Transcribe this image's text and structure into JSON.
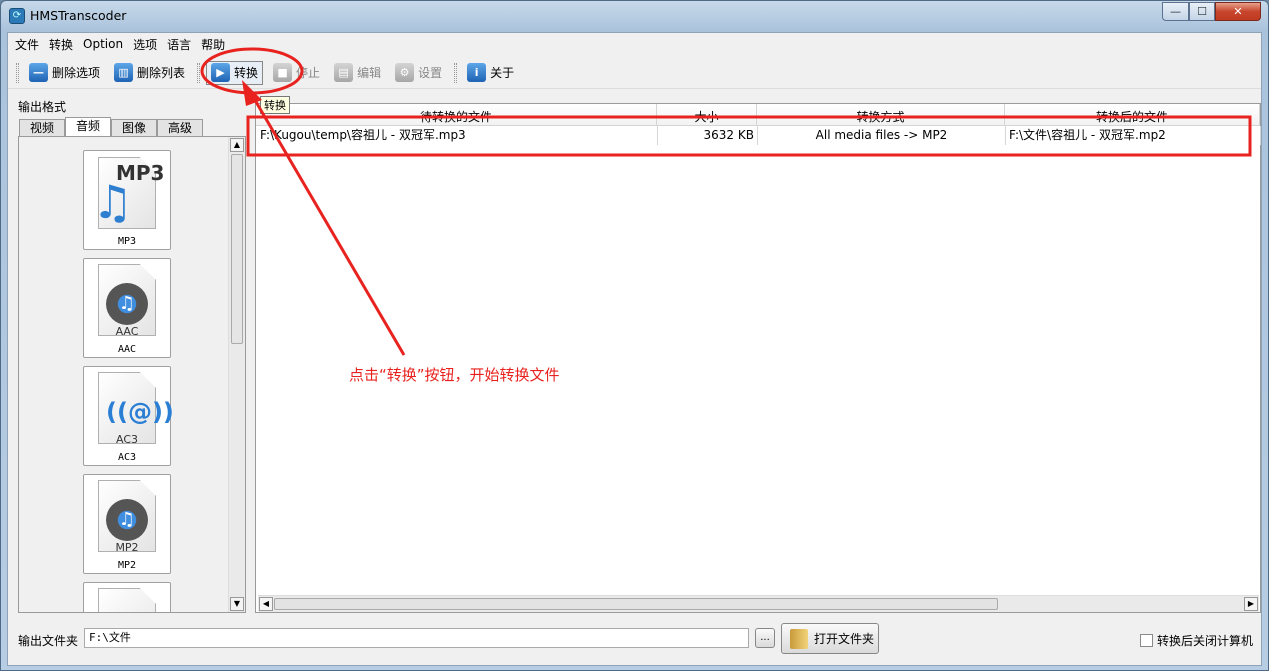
{
  "window": {
    "title": "HMSTranscoder",
    "min": "—",
    "max": "☐",
    "close": "✕"
  },
  "menu": [
    "文件",
    "转换",
    "Option",
    "选项",
    "语言",
    "帮助"
  ],
  "toolbar": {
    "delete_item": "删除选项",
    "delete_list": "删除列表",
    "convert": "转换",
    "stop": "停止",
    "edit": "编辑",
    "settings": "设置",
    "about": "关于"
  },
  "left": {
    "output_format_label": "输出格式",
    "tabs": [
      "视频",
      "音频",
      "图像",
      "高级"
    ],
    "selected_tab": "音频",
    "formats": [
      {
        "label": "MP3",
        "inner": "MP3"
      },
      {
        "label": "AAC",
        "inner": "AAC"
      },
      {
        "label": "AC3",
        "inner": "AC3"
      },
      {
        "label": "MP2",
        "inner": "MP2"
      }
    ]
  },
  "tooltip": "转换",
  "table": {
    "columns": [
      "待转换的文件",
      "大小",
      "转换方式",
      "转换后的文件"
    ],
    "rows": [
      {
        "source": "F:\\Kugou\\temp\\容祖儿 - 双冠军.mp3",
        "size": "3632 KB",
        "method": "All media files -> MP2",
        "output": "F:\\文件\\容祖儿 - 双冠军.mp2"
      }
    ]
  },
  "bottom": {
    "output_folder_label": "输出文件夹",
    "output_folder_value": "F:\\文件",
    "browse": "...",
    "open_folder": "打开文件夹",
    "shutdown_label": "转换后关闭计算机",
    "shutdown_checked": false
  },
  "annotation": {
    "text": "点击“转换”按钮，开始转换文件",
    "color": "#e8231f"
  }
}
